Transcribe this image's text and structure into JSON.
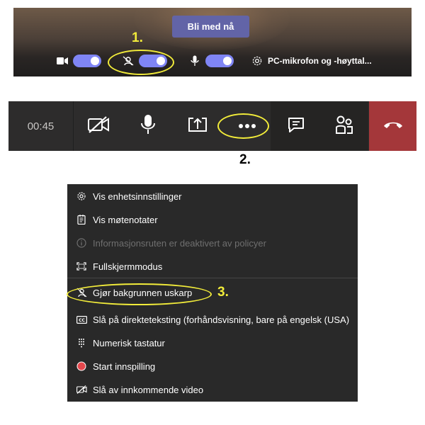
{
  "prejoin": {
    "join_label": "Bli med nå",
    "device_label": "PC-mikrofon og -høyttal...",
    "toggles": [
      {
        "name": "camera",
        "icon": "video-camera-icon",
        "on": true
      },
      {
        "name": "background-blur",
        "icon": "background-blur-icon",
        "on": true
      },
      {
        "name": "microphone",
        "icon": "microphone-icon",
        "on": true
      }
    ],
    "settings_icon": "gear-icon"
  },
  "callbar": {
    "timer": "00:45",
    "buttons": [
      "video-off-icon",
      "microphone-icon",
      "share-screen-icon",
      "more-options-icon",
      "chat-icon",
      "participants-icon",
      "hang-up-icon"
    ]
  },
  "menu": {
    "items": [
      {
        "label": "Vis enhetsinnstillinger",
        "icon": "gear-icon",
        "disabled": false
      },
      {
        "label": "Vis møtenotater",
        "icon": "notes-icon",
        "disabled": false
      },
      {
        "label": "Informasjonsruten er deaktivert av policyer",
        "icon": "info-icon",
        "disabled": true
      },
      {
        "label": "Fullskjermmodus",
        "icon": "fullscreen-icon",
        "disabled": false
      },
      {
        "label": "Gjør bakgrunnen uskarp",
        "icon": "background-blur-icon",
        "disabled": false
      },
      {
        "label": "Slå på direkteteksting (forhåndsvisning, bare på engelsk (USA)",
        "icon": "closed-captions-icon",
        "disabled": false
      },
      {
        "label": "Numerisk tastatur",
        "icon": "dialpad-icon",
        "disabled": false
      },
      {
        "label": "Start innspilling",
        "icon": "record-icon",
        "disabled": false
      },
      {
        "label": "Slå av innkommende video",
        "icon": "video-off-icon",
        "disabled": false
      }
    ]
  },
  "annotations": {
    "step1": "1.",
    "step2": "2.",
    "step3": "3."
  },
  "colors": {
    "accent": "#6264a7",
    "toggle_on": "#7f85f5",
    "hangup": "#a4373a",
    "highlight": "#f2ec3a",
    "record": "#e5484d"
  }
}
